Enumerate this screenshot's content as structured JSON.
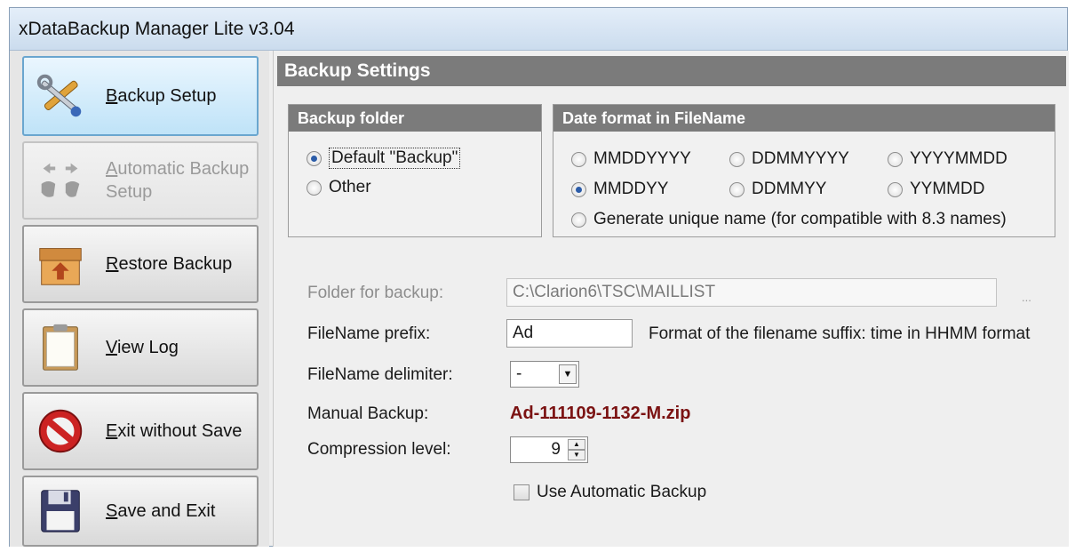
{
  "window": {
    "title": "xDataBackup Manager Lite v3.04"
  },
  "sidebar": {
    "items": [
      {
        "key": "B",
        "rest": "ackup Setup",
        "icon": "tools-icon",
        "state": "active"
      },
      {
        "key": "A",
        "rest": "utomatic Backup",
        "line2": "Setup",
        "icon": "automatic-backup-icon",
        "state": "disabled"
      },
      {
        "key": "R",
        "rest": "estore Backup",
        "icon": "restore-box-icon",
        "state": "normal"
      },
      {
        "key": "V",
        "rest": "iew Log",
        "icon": "clipboard-log-icon",
        "state": "normal"
      },
      {
        "key": "E",
        "rest": "xit without Save",
        "icon": "no-entry-icon",
        "state": "normal"
      },
      {
        "key": "S",
        "rest": "ave and Exit",
        "icon": "floppy-disk-icon",
        "state": "normal"
      }
    ]
  },
  "main": {
    "section_title": "Backup Settings",
    "backup_folder": {
      "title": "Backup folder",
      "options": [
        "Default \"Backup\"",
        "Other"
      ],
      "selected": 0
    },
    "date_format": {
      "title": "Date format in FileName",
      "options": [
        "MMDDYYYY",
        "DDMMYYYY",
        "YYYYMMDD",
        "MMDDYY",
        "DDMMYY",
        "YYMMDD"
      ],
      "unique": "Generate unique name (for compatible with 8.3 names)",
      "selected": 3
    },
    "fields": {
      "folder_label": "Folder for backup:",
      "folder_value": "C:\\Clarion6\\TSC\\MAILLIST",
      "browse": "...",
      "prefix_label": "FileName prefix:",
      "prefix_value": "Ad",
      "suffix_hint": "Format of the filename suffix: time in HHMM format",
      "delimiter_label": "FileName delimiter:",
      "delimiter_value": "-",
      "manual_label": "Manual Backup:",
      "manual_value": "Ad-111109-1132-M.zip",
      "compression_label": "Compression level:",
      "compression_value": "9",
      "auto_backup_label": "Use Automatic Backup"
    }
  },
  "colors": {
    "group_header": "#7b7b7b",
    "active_nav": "#bfe3f8",
    "filename_result": "#7b1212"
  }
}
